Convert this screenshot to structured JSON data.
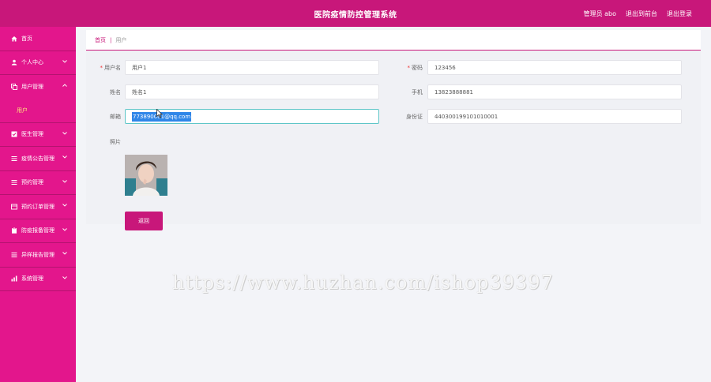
{
  "header": {
    "title": "医院疫情防控管理系统",
    "user": "管理员 abo",
    "back_to_frontend": "退出到前台",
    "logout": "退出登录"
  },
  "sidebar": {
    "items": [
      {
        "label": "首页",
        "icon": "home-icon"
      },
      {
        "label": "个人中心",
        "icon": "user-icon"
      },
      {
        "label": "用户管理",
        "icon": "copy-icon",
        "expanded": true,
        "sub": [
          "用户"
        ]
      },
      {
        "label": "医生管理",
        "icon": "check-square-icon"
      },
      {
        "label": "疫情公告管理",
        "icon": "list-icon"
      },
      {
        "label": "预约管理",
        "icon": "list-icon"
      },
      {
        "label": "预约订单管理",
        "icon": "table-icon"
      },
      {
        "label": "防疫报备管理",
        "icon": "clipboard-icon"
      },
      {
        "label": "异样报告管理",
        "icon": "list-icon"
      },
      {
        "label": "系统管理",
        "icon": "chart-icon"
      }
    ]
  },
  "breadcrumb": {
    "home": "首页",
    "current": "用户"
  },
  "form": {
    "username_label": "用户名",
    "username_value": "用户1",
    "password_label": "密码",
    "password_value": "123456",
    "name_label": "姓名",
    "name_value": "姓名1",
    "phone_label": "手机",
    "phone_value": "13823888881",
    "email_label": "邮箱",
    "email_value": "773890001@qq.com",
    "idcard_label": "身份证",
    "idcard_value": "440300199101010001",
    "photo_label": "照片",
    "back_label": "返回"
  },
  "watermark": "https://www.huzhan.com/ishop39397",
  "colors": {
    "accent": "#c8177a",
    "sidebar": "#e3168c",
    "submenu_text": "#ffe47a",
    "selection": "#2f86e8"
  }
}
